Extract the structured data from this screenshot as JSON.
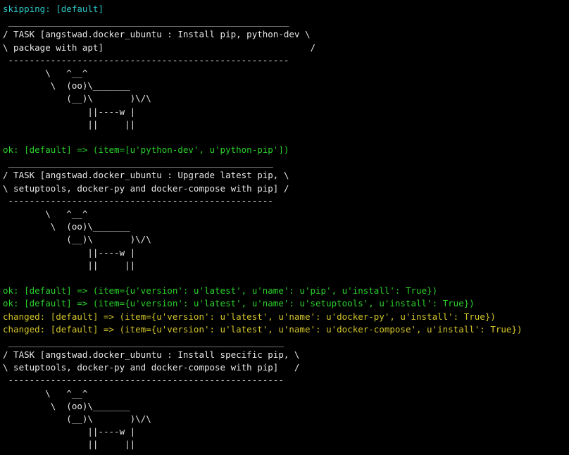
{
  "terminal": {
    "lines": [
      {
        "text": "skipping: [default]",
        "color": "#2fc6c6"
      },
      {
        "text": " _____________________________________________________",
        "color": "#e8e8e8"
      },
      {
        "text": "/ TASK [angstwad.docker_ubuntu : Install pip, python-dev \\",
        "color": "#e8e8e8"
      },
      {
        "text": "\\ package with apt]                                       /",
        "color": "#e8e8e8"
      },
      {
        "text": " -----------------------------------------------------",
        "color": "#e8e8e8"
      },
      {
        "text": "        \\   ^__^",
        "color": "#e8e8e8"
      },
      {
        "text": "         \\  (oo)\\_______",
        "color": "#e8e8e8"
      },
      {
        "text": "            (__)\\       )\\/\\",
        "color": "#e8e8e8"
      },
      {
        "text": "                ||----w |",
        "color": "#e8e8e8"
      },
      {
        "text": "                ||     ||",
        "color": "#e8e8e8"
      },
      {
        "text": "",
        "color": "#e8e8e8"
      },
      {
        "text": "ok: [default] => (item=[u'python-dev', u'python-pip'])",
        "color": "#2ad12a"
      },
      {
        "text": " __________________________________________________",
        "color": "#e8e8e8"
      },
      {
        "text": "/ TASK [angstwad.docker_ubuntu : Upgrade latest pip, \\",
        "color": "#e8e8e8"
      },
      {
        "text": "\\ setuptools, docker-py and docker-compose with pip] /",
        "color": "#e8e8e8"
      },
      {
        "text": " --------------------------------------------------",
        "color": "#e8e8e8"
      },
      {
        "text": "        \\   ^__^",
        "color": "#e8e8e8"
      },
      {
        "text": "         \\  (oo)\\_______",
        "color": "#e8e8e8"
      },
      {
        "text": "            (__)\\       )\\/\\",
        "color": "#e8e8e8"
      },
      {
        "text": "                ||----w |",
        "color": "#e8e8e8"
      },
      {
        "text": "                ||     ||",
        "color": "#e8e8e8"
      },
      {
        "text": "",
        "color": "#e8e8e8"
      },
      {
        "text": "ok: [default] => (item={u'version': u'latest', u'name': u'pip', u'install': True})",
        "color": "#2ad12a"
      },
      {
        "text": "ok: [default] => (item={u'version': u'latest', u'name': u'setuptools', u'install': True})",
        "color": "#2ad12a"
      },
      {
        "text": "changed: [default] => (item={u'version': u'latest', u'name': u'docker-py', u'install': True})",
        "color": "#d2c42a"
      },
      {
        "text": "changed: [default] => (item={u'version': u'latest', u'name': u'docker-compose', u'install': True})",
        "color": "#d2c42a"
      },
      {
        "text": " ____________________________________________________",
        "color": "#e8e8e8"
      },
      {
        "text": "/ TASK [angstwad.docker_ubuntu : Install specific pip, \\",
        "color": "#e8e8e8"
      },
      {
        "text": "\\ setuptools, docker-py and docker-compose with pip]   /",
        "color": "#e8e8e8"
      },
      {
        "text": " ----------------------------------------------------",
        "color": "#e8e8e8"
      },
      {
        "text": "        \\   ^__^",
        "color": "#e8e8e8"
      },
      {
        "text": "         \\  (oo)\\_______",
        "color": "#e8e8e8"
      },
      {
        "text": "            (__)\\       )\\/\\",
        "color": "#e8e8e8"
      },
      {
        "text": "                ||----w |",
        "color": "#e8e8e8"
      },
      {
        "text": "                ||     ||",
        "color": "#e8e8e8"
      }
    ]
  }
}
